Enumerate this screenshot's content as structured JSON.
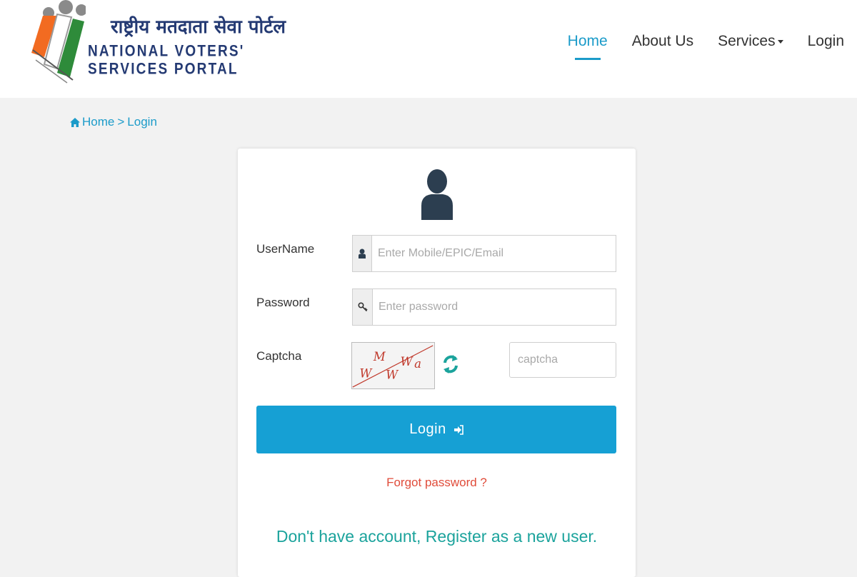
{
  "header": {
    "logo_hindi": "राष्ट्रीय मतदाता सेवा पोर्टल",
    "logo_english": "NATIONAL VOTERS' SERVICES PORTAL",
    "nav": [
      {
        "label": "Home",
        "active": true
      },
      {
        "label": "About Us",
        "active": false
      },
      {
        "label": "Services",
        "active": false,
        "dropdown": true
      },
      {
        "label": "Login",
        "active": false
      }
    ]
  },
  "breadcrumb": {
    "home": "Home",
    "separator": ">",
    "current": "Login"
  },
  "form": {
    "username_label": "UserName",
    "username_placeholder": "Enter Mobile/EPIC/Email",
    "password_label": "Password",
    "password_placeholder": "Enter password",
    "captcha_label": "Captcha",
    "captcha_text": [
      "W",
      "M",
      "W",
      "W",
      "a"
    ],
    "captcha_placeholder": "captcha",
    "login_button": "Login",
    "forgot_password": "Forgot password ?",
    "register_link": "Don't have account, Register as a new user."
  },
  "icons": {
    "home": "home-icon",
    "user": "user-icon",
    "key": "key-icon",
    "refresh": "refresh-icon",
    "sign_in": "sign-in-icon"
  },
  "colors": {
    "accent": "#1b9bc9",
    "button": "#16a0d4",
    "forgot": "#e04c3a",
    "register": "#1ba39c",
    "navy": "#243a73",
    "logo_saffron": "#f26b21",
    "logo_green": "#2e8b3a"
  }
}
